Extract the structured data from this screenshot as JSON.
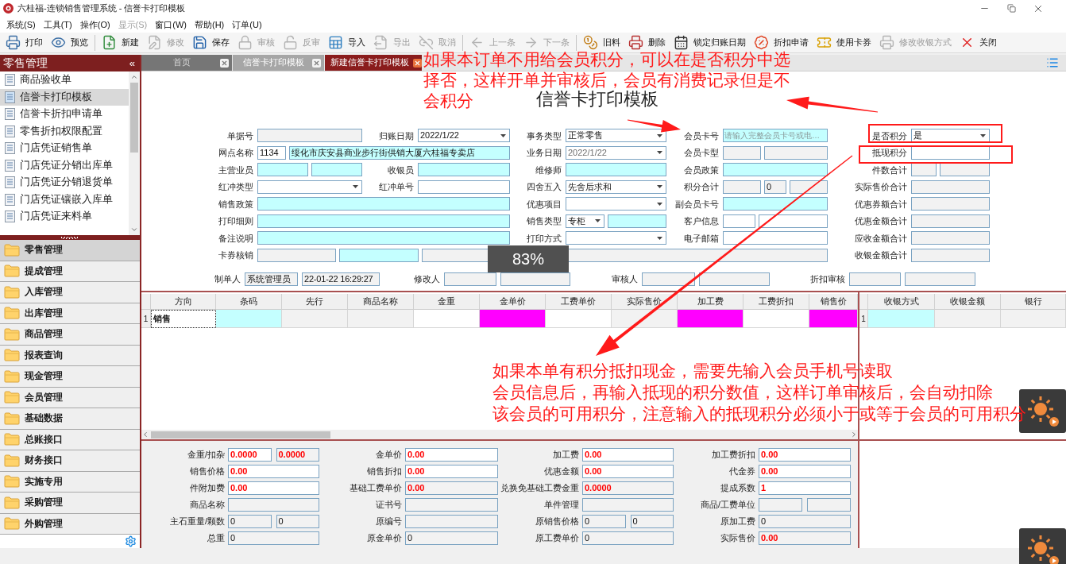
{
  "window": {
    "title": "六桂福-连锁销售管理系统 - 信誉卡打印模板"
  },
  "menu": [
    {
      "label": "系统(S)",
      "disabled": false
    },
    {
      "label": "工具(T)",
      "disabled": false
    },
    {
      "label": "操作(O)",
      "disabled": false
    },
    {
      "label": "显示(S)",
      "disabled": true
    },
    {
      "label": "窗口(W)",
      "disabled": false
    },
    {
      "label": "帮助(H)",
      "disabled": false
    },
    {
      "label": "订单(U)",
      "disabled": false
    }
  ],
  "toolbar": [
    {
      "buttons": [
        {
          "label": "打印",
          "disabled": false
        },
        {
          "label": "预览",
          "disabled": false
        }
      ]
    },
    {
      "buttons": [
        {
          "label": "新建",
          "disabled": false
        },
        {
          "label": "修改",
          "disabled": true
        },
        {
          "label": "保存",
          "disabled": false
        },
        {
          "label": "审核",
          "disabled": true
        },
        {
          "label": "反审",
          "disabled": true
        },
        {
          "label": "导入",
          "disabled": false
        },
        {
          "label": "导出",
          "disabled": true
        },
        {
          "label": "取消",
          "disabled": true
        }
      ]
    },
    {
      "buttons": [
        {
          "label": "上一条",
          "disabled": true
        },
        {
          "label": "下一条",
          "disabled": true
        }
      ]
    },
    {
      "buttons": [
        {
          "label": "旧料",
          "disabled": false
        },
        {
          "label": "删除",
          "disabled": false
        },
        {
          "label": "锁定归账日期",
          "disabled": false
        },
        {
          "label": "折扣申请",
          "disabled": false
        },
        {
          "label": "使用卡券",
          "disabled": false
        },
        {
          "label": "修改收银方式",
          "disabled": true
        },
        {
          "label": "关闭",
          "disabled": false
        }
      ]
    }
  ],
  "sidebar": {
    "title": "零售管理",
    "collapse_glyph": "«",
    "items": [
      {
        "label": "商品验收单",
        "selected": false
      },
      {
        "label": "信誉卡打印模板",
        "selected": true
      },
      {
        "label": "信誉卡折扣申请单",
        "selected": false
      },
      {
        "label": "零售折扣权限配置",
        "selected": false
      },
      {
        "label": "门店凭证销售单",
        "selected": false
      },
      {
        "label": "门店凭证分销出库单",
        "selected": false
      },
      {
        "label": "门店凭证分销退货单",
        "selected": false
      },
      {
        "label": "门店凭证镶嵌入库单",
        "selected": false
      },
      {
        "label": "门店凭证来料单",
        "selected": false
      }
    ],
    "groups": [
      {
        "label": "零售管理",
        "selected": true
      },
      {
        "label": "提成管理",
        "selected": false
      },
      {
        "label": "入库管理",
        "selected": false
      },
      {
        "label": "出库管理",
        "selected": false
      },
      {
        "label": "商品管理",
        "selected": false
      },
      {
        "label": "报表查询",
        "selected": false
      },
      {
        "label": "现金管理",
        "selected": false
      },
      {
        "label": "会员管理",
        "selected": false
      },
      {
        "label": "基础数据",
        "selected": false
      },
      {
        "label": "总账接口",
        "selected": false
      },
      {
        "label": "财务接口",
        "selected": false
      },
      {
        "label": "实施专用",
        "selected": false
      },
      {
        "label": "采购管理",
        "selected": false
      },
      {
        "label": "外购管理",
        "selected": false
      }
    ]
  },
  "tabs": [
    {
      "label": "首页",
      "selected": false
    },
    {
      "label": "信誉卡打印模板",
      "selected": false
    },
    {
      "label": "新建信誉卡打印模板",
      "selected": true
    }
  ],
  "form": {
    "title": "信誉卡打印模板",
    "rows": [
      [
        {
          "label": "单据号",
          "inputs": [
            {
              "kind": "readonly"
            }
          ]
        },
        {
          "label": "归账日期",
          "inputs": [
            {
              "kind": "select",
              "value": "2022/1/22"
            }
          ]
        },
        {
          "label": "事务类型",
          "inputs": [
            {
              "kind": "select",
              "value": "正常零售"
            }
          ]
        },
        {
          "label": "会员卡号",
          "inputs": [
            {
              "kind": "lookup",
              "placeholder": "请输入完整会员卡号或电…"
            }
          ]
        }
      ],
      [
        {
          "label": "网点名称",
          "inputs": [
            {
              "kind": "text",
              "value": "1134"
            },
            {
              "kind": "lookup",
              "value": "绥化市庆安县商业步行街供销大厦六桂福专卖店"
            }
          ]
        },
        {
          "label": "业务日期",
          "inputs": [
            {
              "kind": "locked",
              "value": "2022/1/22"
            }
          ]
        },
        {
          "label": "会员卡型",
          "inputs": [
            {
              "kind": "readonly"
            },
            {
              "kind": "readonly"
            }
          ]
        }
      ],
      [
        {
          "label": "主营业员",
          "inputs": [
            {
              "kind": "lookup"
            },
            {
              "kind": "lookup"
            }
          ]
        },
        {
          "label": "收银员",
          "inputs": [
            {
              "kind": "lookup"
            }
          ]
        },
        {
          "label": "维修师",
          "inputs": [
            {
              "kind": "lookup"
            }
          ]
        },
        {
          "label": "会员政策",
          "inputs": [
            {
              "kind": "lookup"
            }
          ]
        }
      ],
      [
        {
          "label": "红冲类型",
          "inputs": [
            {
              "kind": "select"
            }
          ]
        },
        {
          "label": "红冲单号",
          "inputs": [
            {
              "kind": "text"
            }
          ]
        },
        {
          "label": "四舍五入",
          "inputs": [
            {
              "kind": "select",
              "value": "先舍后求和"
            }
          ]
        },
        {
          "label": "积分合计",
          "inputs": [
            {
              "kind": "readonly"
            },
            {
              "kind": "readonly",
              "value": "0"
            },
            {
              "kind": "readonly"
            }
          ]
        }
      ],
      [
        {
          "label": "销售政策",
          "inputs": [
            {
              "kind": "lookup"
            }
          ]
        },
        {
          "label": "优惠项目",
          "inputs": [
            {
              "kind": "select"
            }
          ]
        },
        {
          "label": "副会员卡号",
          "inputs": [
            {
              "kind": "lookup"
            }
          ]
        }
      ],
      [
        {
          "label": "打印细则",
          "inputs": [
            {
              "kind": "lookup"
            }
          ]
        },
        {
          "label": "销售类型",
          "inputs": [
            {
              "kind": "select",
              "value": "专柜"
            },
            {
              "kind": "lookup"
            }
          ]
        },
        {
          "label": "客户信息",
          "inputs": [
            {
              "kind": "text"
            },
            {
              "kind": "text"
            }
          ]
        }
      ],
      [
        {
          "label": "备注说明",
          "inputs": [
            {
              "kind": "lookup"
            }
          ]
        },
        {
          "label": "打印方式",
          "inputs": [
            {
              "kind": "select"
            }
          ]
        },
        {
          "label": "电子邮箱",
          "inputs": [
            {
              "kind": "text"
            }
          ]
        }
      ],
      [
        {
          "label": "卡券核销",
          "inputs": [
            {
              "kind": "readonly"
            },
            {
              "kind": "lookup"
            },
            {
              "kind": "readonly"
            },
            {
              "kind": "readonly"
            }
          ]
        }
      ]
    ],
    "summary": [
      {
        "label": "是否积分",
        "inputs": [
          {
            "kind": "select",
            "value": "是"
          }
        ]
      },
      {
        "label": "抵现积分",
        "inputs": [
          {
            "kind": "text"
          }
        ]
      },
      {
        "label": "件数合计",
        "inputs": [
          {
            "kind": "readonly"
          },
          {
            "kind": "readonly"
          }
        ]
      },
      {
        "label": "实际售价合计",
        "inputs": [
          {
            "kind": "readonly"
          }
        ]
      },
      {
        "label": "优惠券额合计",
        "inputs": [
          {
            "kind": "readonly"
          }
        ]
      },
      {
        "label": "优惠金额合计",
        "inputs": [
          {
            "kind": "readonly"
          }
        ]
      },
      {
        "label": "应收金额合计",
        "inputs": [
          {
            "kind": "readonly"
          }
        ]
      },
      {
        "label": "收银金额合计",
        "inputs": [
          {
            "kind": "readonly"
          }
        ]
      }
    ],
    "audit": [
      {
        "label": "制单人",
        "inputs": [
          {
            "kind": "readonly",
            "value": "系统管理员"
          },
          {
            "kind": "readonly",
            "value": "22-01-22 16:29:27"
          }
        ]
      },
      {
        "label": "修改人",
        "inputs": [
          {
            "kind": "readonly"
          },
          {
            "kind": "readonly"
          }
        ]
      },
      {
        "label": "审核人",
        "inputs": [
          {
            "kind": "readonly"
          },
          {
            "kind": "readonly"
          }
        ]
      },
      {
        "label": "折扣审核",
        "inputs": [
          {
            "kind": "readonly"
          },
          {
            "kind": "readonly"
          }
        ]
      }
    ]
  },
  "order_grid": {
    "columns": [
      "方向",
      "条码",
      "先行",
      "商品名称",
      "金重",
      "金单价",
      "工费单价",
      "实际售价",
      "加工费",
      "工费折扣",
      "销售价"
    ],
    "rows": [
      {
        "number": "1",
        "cells": [
          {
            "kind": "focused",
            "value": "销售"
          },
          {
            "kind": "lookup"
          },
          {
            "kind": "readonly"
          },
          {
            "kind": "readonly"
          },
          {
            "kind": "plain"
          },
          {
            "kind": "required"
          },
          {
            "kind": "plain"
          },
          {
            "kind": "readonly"
          },
          {
            "kind": "required"
          },
          {
            "kind": "plain"
          },
          {
            "kind": "required"
          }
        ]
      }
    ]
  },
  "payment_grid": {
    "columns": [
      "收银方式",
      "收银金额",
      "银行"
    ],
    "rows": [
      {
        "number": "1",
        "cells": [
          {
            "kind": "lookup"
          },
          {
            "kind": "readonly"
          },
          {
            "kind": "readonly"
          }
        ]
      }
    ]
  },
  "details": [
    [
      {
        "label": "金重/扣杂",
        "inputs": [
          {
            "kind": "amount",
            "value": "0.0000"
          },
          {
            "kind": "fixed",
            "value": "0.0000"
          }
        ]
      },
      {
        "label": "金单价",
        "inputs": [
          {
            "kind": "amount",
            "value": "0.00"
          }
        ]
      },
      {
        "label": "加工费",
        "inputs": [
          {
            "kind": "amount",
            "value": "0.00"
          }
        ]
      },
      {
        "label": "加工费折扣",
        "inputs": [
          {
            "kind": "amount",
            "value": "0.00"
          }
        ]
      }
    ],
    [
      {
        "label": "销售价格",
        "inputs": [
          {
            "kind": "amount",
            "value": "0.00"
          }
        ]
      },
      {
        "label": "销售折扣",
        "inputs": [
          {
            "kind": "amount",
            "value": "0.00"
          }
        ]
      },
      {
        "label": "优惠金额",
        "inputs": [
          {
            "kind": "amount",
            "value": "0.00"
          }
        ]
      },
      {
        "label": "代金券",
        "inputs": [
          {
            "kind": "amount",
            "value": "0.00"
          }
        ]
      }
    ],
    [
      {
        "label": "件附加费",
        "inputs": [
          {
            "kind": "amount",
            "value": "0.00"
          }
        ]
      },
      {
        "label": "基础工费单价",
        "inputs": [
          {
            "kind": "fixed",
            "value": "0.00"
          }
        ]
      },
      {
        "label": "兑换免基础工费金重",
        "inputs": [
          {
            "kind": "fixed",
            "value": "0.0000"
          }
        ]
      },
      {
        "label": "提成系数",
        "inputs": [
          {
            "kind": "amount",
            "value": "1"
          }
        ]
      }
    ],
    [
      {
        "label": "商品名称",
        "inputs": [
          {
            "kind": "readonly"
          }
        ]
      },
      {
        "label": "证书号",
        "inputs": [
          {
            "kind": "readonly"
          }
        ]
      },
      {
        "label": "单件管理",
        "inputs": [
          {
            "kind": "readonly"
          }
        ]
      },
      {
        "label": "商品/工费单位",
        "inputs": [
          {
            "kind": "readonly"
          },
          {
            "kind": "readonly"
          }
        ]
      }
    ],
    [
      {
        "label": "主石重量/颗数",
        "inputs": [
          {
            "kind": "readonly",
            "value": "0"
          },
          {
            "kind": "readonly",
            "value": "0"
          }
        ]
      },
      {
        "label": "原编号",
        "inputs": [
          {
            "kind": "readonly"
          }
        ]
      },
      {
        "label": "原销售价格",
        "inputs": [
          {
            "kind": "readonly",
            "value": "0"
          },
          {
            "kind": "readonly",
            "value": "0"
          }
        ]
      },
      {
        "label": "原加工费",
        "inputs": [
          {
            "kind": "readonly",
            "value": "0"
          }
        ]
      }
    ],
    [
      {
        "label": "总重",
        "inputs": [
          {
            "kind": "readonly",
            "value": "0"
          }
        ]
      },
      {
        "label": "原金单价",
        "inputs": [
          {
            "kind": "readonly",
            "value": "0"
          }
        ]
      },
      {
        "label": "原工费单价",
        "inputs": [
          {
            "kind": "readonly",
            "value": "0"
          }
        ]
      },
      {
        "label": "实际售价",
        "inputs": [
          {
            "kind": "fixed",
            "value": "0.00"
          }
        ]
      }
    ]
  ],
  "zoom_indicator": "83%",
  "annotations": [
    {
      "lines": [
        "如果本订单不用给会员积分，可以在是否积分中选",
        "择否，这样开单并审核后，会员有消费记录但是不",
        "会积分"
      ]
    },
    {
      "lines": [
        "如果本单有积分抵扣现金，需要先输入会员手机号读取",
        "会员信息后，再输入抵现的积分数值，这样订单审核后，会自动扣除",
        "该会员的可用积分，注意输入的抵现积分必须小于或等于会员的可用积分"
      ]
    }
  ]
}
